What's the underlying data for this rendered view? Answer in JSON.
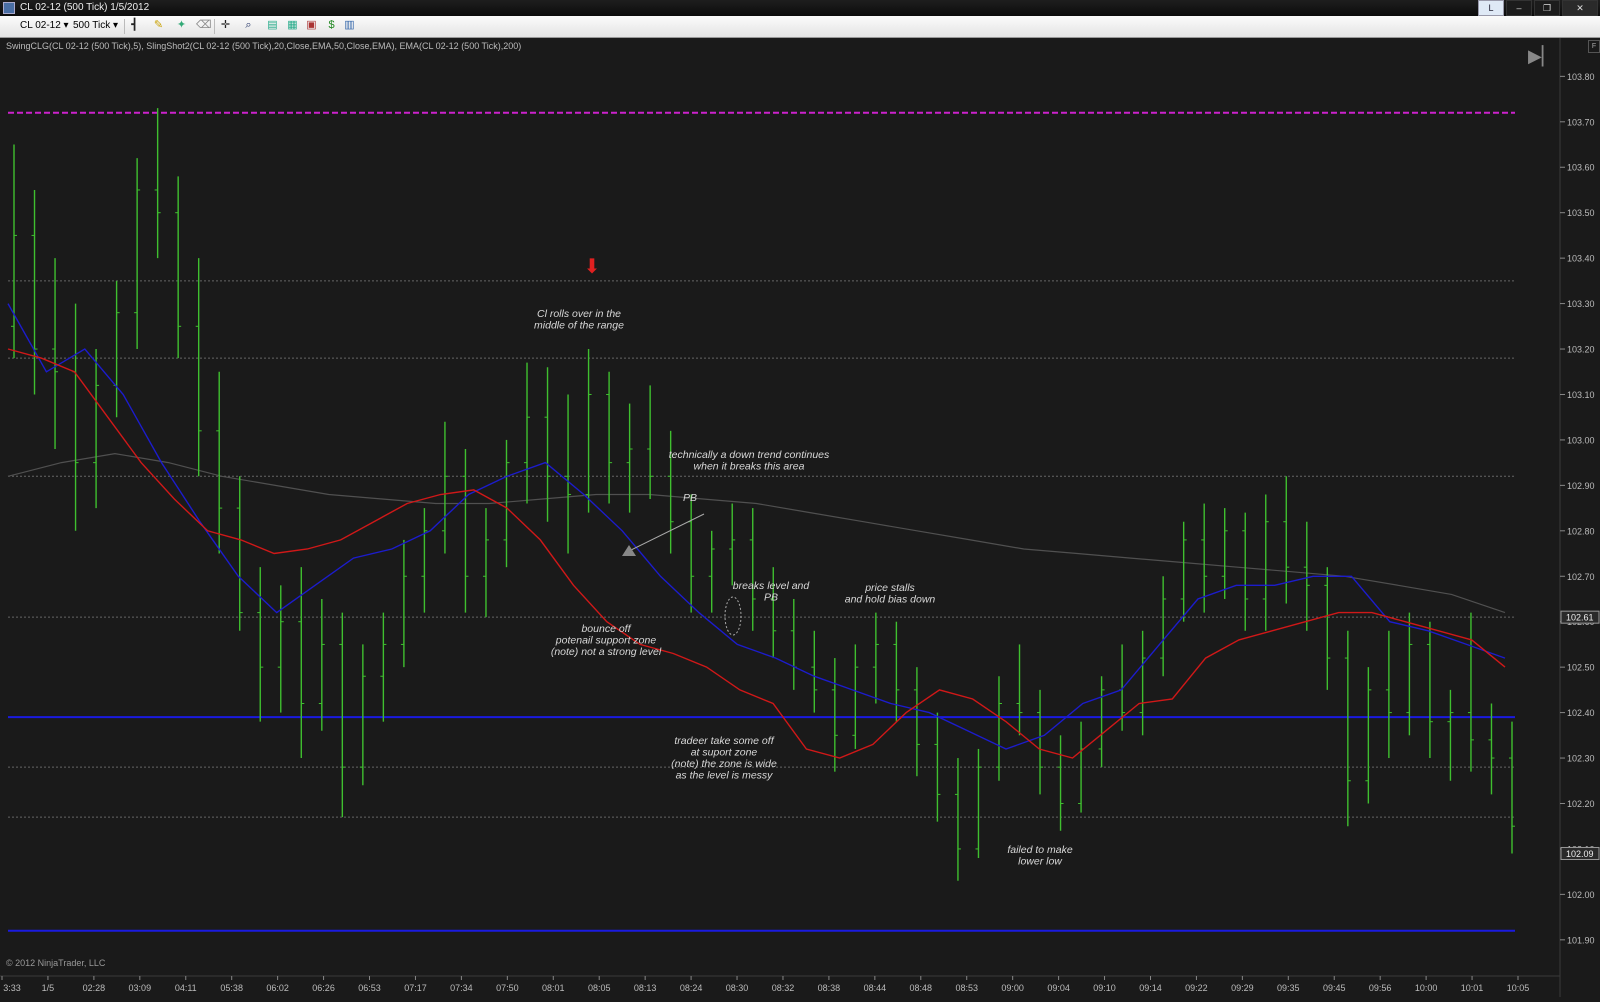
{
  "window": {
    "title": "CL 02-12 (500 Tick)  1/5/2012",
    "buttons": [
      "L",
      "–",
      "❐",
      "✕"
    ]
  },
  "toolbar": {
    "instrument": "CL 02-12",
    "interval": "500 Tick",
    "icons": [
      "bar-style-icon",
      "pencil-icon",
      "pin-icon",
      "eraser-icon",
      "crosshair-icon",
      "magnify-icon",
      "strategy-icon",
      "data-box-icon",
      "properties-icon",
      "save-icon",
      "layout-icon"
    ]
  },
  "indicator_label": "SwingCLG(CL 02-12 (500 Tick),5), SlingShot2(CL 02-12 (500 Tick),20,Close,EMA,50,Close,EMA), EMA(CL 02-12 (500 Tick),200)",
  "copyright": "© 2012 NinjaTrader, LLC",
  "colors": {
    "background": "#1a1a1a",
    "bars": "#3fbf2f",
    "ema_fast": "#d01818",
    "ema_slow": "#1c1ccc",
    "ema_200": "#505050",
    "level_magenta": "#cc22cc",
    "level_blue": "#1a1ae0",
    "level_gray": "#666666",
    "arrow_red": "#e02020"
  },
  "chart_data": {
    "type": "ohlc",
    "instrument": "CL 02-12",
    "interval": "500 Tick",
    "y_axis": {
      "range": [
        101.86,
        103.88
      ],
      "ticks": [
        "103.80",
        "103.70",
        "103.60",
        "103.50",
        "103.40",
        "103.30",
        "103.20",
        "103.10",
        "103.00",
        "102.90",
        "102.80",
        "102.70",
        "102.60",
        "102.50",
        "102.40",
        "102.30",
        "102.20",
        "102.10",
        "102.00",
        "101.90"
      ]
    },
    "x_axis": {
      "ticks": [
        "3:33",
        "1/5",
        "02:28",
        "03:09",
        "04:11",
        "05:38",
        "06:02",
        "06:26",
        "06:53",
        "07:17",
        "07:34",
        "07:50",
        "08:01",
        "08:05",
        "08:13",
        "08:24",
        "08:30",
        "08:32",
        "08:38",
        "08:44",
        "08:48",
        "08:53",
        "09:00",
        "09:04",
        "09:10",
        "09:14",
        "09:22",
        "09:29",
        "09:35",
        "09:45",
        "09:56",
        "10:00",
        "10:01",
        "10:05"
      ]
    },
    "price_markers": [
      {
        "label": "102.61",
        "value": 102.61
      },
      {
        "label": "102.09",
        "value": 102.09
      }
    ],
    "bars": [
      {
        "o": 103.25,
        "h": 103.65,
        "l": 103.18,
        "c": 103.45
      },
      {
        "o": 103.45,
        "h": 103.55,
        "l": 103.1,
        "c": 103.2
      },
      {
        "o": 103.2,
        "h": 103.4,
        "l": 102.98,
        "c": 103.15
      },
      {
        "o": 103.15,
        "h": 103.3,
        "l": 102.8,
        "c": 102.95
      },
      {
        "o": 102.95,
        "h": 103.2,
        "l": 102.85,
        "c": 103.12
      },
      {
        "o": 103.12,
        "h": 103.35,
        "l": 103.05,
        "c": 103.28
      },
      {
        "o": 103.28,
        "h": 103.62,
        "l": 103.2,
        "c": 103.55
      },
      {
        "o": 103.55,
        "h": 103.73,
        "l": 103.4,
        "c": 103.5
      },
      {
        "o": 103.5,
        "h": 103.58,
        "l": 103.18,
        "c": 103.25
      },
      {
        "o": 103.25,
        "h": 103.4,
        "l": 102.92,
        "c": 103.02
      },
      {
        "o": 103.02,
        "h": 103.15,
        "l": 102.75,
        "c": 102.85
      },
      {
        "o": 102.85,
        "h": 102.92,
        "l": 102.58,
        "c": 102.62
      },
      {
        "o": 102.62,
        "h": 102.72,
        "l": 102.38,
        "c": 102.5
      },
      {
        "o": 102.5,
        "h": 102.68,
        "l": 102.4,
        "c": 102.6
      },
      {
        "o": 102.6,
        "h": 102.72,
        "l": 102.3,
        "c": 102.42
      },
      {
        "o": 102.42,
        "h": 102.65,
        "l": 102.36,
        "c": 102.55
      },
      {
        "o": 102.55,
        "h": 102.62,
        "l": 102.17,
        "c": 102.28
      },
      {
        "o": 102.28,
        "h": 102.55,
        "l": 102.24,
        "c": 102.48
      },
      {
        "o": 102.48,
        "h": 102.62,
        "l": 102.38,
        "c": 102.55
      },
      {
        "o": 102.55,
        "h": 102.78,
        "l": 102.5,
        "c": 102.7
      },
      {
        "o": 102.7,
        "h": 102.85,
        "l": 102.62,
        "c": 102.8
      },
      {
        "o": 102.8,
        "h": 103.04,
        "l": 102.75,
        "c": 102.92
      },
      {
        "o": 102.92,
        "h": 102.98,
        "l": 102.62,
        "c": 102.7
      },
      {
        "o": 102.7,
        "h": 102.85,
        "l": 102.61,
        "c": 102.78
      },
      {
        "o": 102.78,
        "h": 103.0,
        "l": 102.72,
        "c": 102.95
      },
      {
        "o": 102.95,
        "h": 103.17,
        "l": 102.86,
        "c": 103.05
      },
      {
        "o": 103.05,
        "h": 103.16,
        "l": 102.82,
        "c": 102.92
      },
      {
        "o": 102.92,
        "h": 103.1,
        "l": 102.75,
        "c": 102.88
      },
      {
        "o": 102.88,
        "h": 103.2,
        "l": 102.84,
        "c": 103.1
      },
      {
        "o": 103.1,
        "h": 103.15,
        "l": 102.86,
        "c": 102.95
      },
      {
        "o": 102.95,
        "h": 103.08,
        "l": 102.84,
        "c": 102.98
      },
      {
        "o": 102.98,
        "h": 103.12,
        "l": 102.87,
        "c": 102.92
      },
      {
        "o": 102.92,
        "h": 103.02,
        "l": 102.75,
        "c": 102.82
      },
      {
        "o": 102.82,
        "h": 102.88,
        "l": 102.62,
        "c": 102.7
      },
      {
        "o": 102.7,
        "h": 102.8,
        "l": 102.62,
        "c": 102.76
      },
      {
        "o": 102.76,
        "h": 102.86,
        "l": 102.68,
        "c": 102.78
      },
      {
        "o": 102.78,
        "h": 102.85,
        "l": 102.58,
        "c": 102.65
      },
      {
        "o": 102.65,
        "h": 102.72,
        "l": 102.52,
        "c": 102.58
      },
      {
        "o": 102.58,
        "h": 102.65,
        "l": 102.45,
        "c": 102.5
      },
      {
        "o": 102.5,
        "h": 102.58,
        "l": 102.4,
        "c": 102.45
      },
      {
        "o": 102.45,
        "h": 102.52,
        "l": 102.27,
        "c": 102.35
      },
      {
        "o": 102.35,
        "h": 102.55,
        "l": 102.32,
        "c": 102.5
      },
      {
        "o": 102.5,
        "h": 102.62,
        "l": 102.42,
        "c": 102.55
      },
      {
        "o": 102.55,
        "h": 102.6,
        "l": 102.38,
        "c": 102.45
      },
      {
        "o": 102.45,
        "h": 102.5,
        "l": 102.26,
        "c": 102.33
      },
      {
        "o": 102.33,
        "h": 102.4,
        "l": 102.16,
        "c": 102.22
      },
      {
        "o": 102.22,
        "h": 102.3,
        "l": 102.03,
        "c": 102.1
      },
      {
        "o": 102.1,
        "h": 102.32,
        "l": 102.08,
        "c": 102.28
      },
      {
        "o": 102.28,
        "h": 102.48,
        "l": 102.25,
        "c": 102.42
      },
      {
        "o": 102.42,
        "h": 102.55,
        "l": 102.35,
        "c": 102.4
      },
      {
        "o": 102.4,
        "h": 102.45,
        "l": 102.22,
        "c": 102.28
      },
      {
        "o": 102.28,
        "h": 102.35,
        "l": 102.14,
        "c": 102.2
      },
      {
        "o": 102.2,
        "h": 102.38,
        "l": 102.18,
        "c": 102.32
      },
      {
        "o": 102.32,
        "h": 102.48,
        "l": 102.28,
        "c": 102.45
      },
      {
        "o": 102.45,
        "h": 102.55,
        "l": 102.36,
        "c": 102.4
      },
      {
        "o": 102.4,
        "h": 102.58,
        "l": 102.35,
        "c": 102.52
      },
      {
        "o": 102.52,
        "h": 102.7,
        "l": 102.48,
        "c": 102.65
      },
      {
        "o": 102.65,
        "h": 102.82,
        "l": 102.6,
        "c": 102.78
      },
      {
        "o": 102.78,
        "h": 102.86,
        "l": 102.62,
        "c": 102.7
      },
      {
        "o": 102.7,
        "h": 102.85,
        "l": 102.65,
        "c": 102.8
      },
      {
        "o": 102.8,
        "h": 102.84,
        "l": 102.58,
        "c": 102.65
      },
      {
        "o": 102.65,
        "h": 102.88,
        "l": 102.58,
        "c": 102.82
      },
      {
        "o": 102.82,
        "h": 102.92,
        "l": 102.64,
        "c": 102.72
      },
      {
        "o": 102.72,
        "h": 102.82,
        "l": 102.58,
        "c": 102.68
      },
      {
        "o": 102.68,
        "h": 102.72,
        "l": 102.45,
        "c": 102.52
      },
      {
        "o": 102.52,
        "h": 102.58,
        "l": 102.15,
        "c": 102.25
      },
      {
        "o": 102.25,
        "h": 102.5,
        "l": 102.2,
        "c": 102.45
      },
      {
        "o": 102.45,
        "h": 102.58,
        "l": 102.3,
        "c": 102.4
      },
      {
        "o": 102.4,
        "h": 102.62,
        "l": 102.35,
        "c": 102.55
      },
      {
        "o": 102.55,
        "h": 102.6,
        "l": 102.3,
        "c": 102.38
      },
      {
        "o": 102.38,
        "h": 102.45,
        "l": 102.25,
        "c": 102.4
      },
      {
        "o": 102.4,
        "h": 102.62,
        "l": 102.27,
        "c": 102.34
      },
      {
        "o": 102.34,
        "h": 102.42,
        "l": 102.22,
        "c": 102.3
      },
      {
        "o": 102.3,
        "h": 102.38,
        "l": 102.09,
        "c": 102.15
      }
    ],
    "ema_fast": [
      103.2,
      103.18,
      103.15,
      103.05,
      102.95,
      102.87,
      102.8,
      102.78,
      102.75,
      102.76,
      102.78,
      102.82,
      102.86,
      102.88,
      102.89,
      102.85,
      102.78,
      102.68,
      102.6,
      102.55,
      102.53,
      102.5,
      102.45,
      102.42,
      102.32,
      102.3,
      102.33,
      102.4,
      102.45,
      102.43,
      102.38,
      102.32,
      102.3,
      102.36,
      102.42,
      102.43,
      102.52,
      102.56,
      102.58,
      102.6,
      102.62,
      102.62,
      102.6,
      102.58,
      102.56,
      102.5
    ],
    "ema_slow": [
      103.3,
      103.15,
      103.2,
      103.1,
      102.95,
      102.82,
      102.7,
      102.62,
      102.68,
      102.74,
      102.76,
      102.8,
      102.88,
      102.92,
      102.95,
      102.88,
      102.8,
      102.7,
      102.62,
      102.55,
      102.52,
      102.48,
      102.45,
      102.42,
      102.4,
      102.36,
      102.32,
      102.35,
      102.42,
      102.45,
      102.55,
      102.65,
      102.68,
      102.68,
      102.7,
      102.7,
      102.6,
      102.58,
      102.55,
      102.52
    ],
    "ema_200": [
      102.92,
      102.95,
      102.97,
      102.95,
      102.92,
      102.9,
      102.88,
      102.87,
      102.86,
      102.86,
      102.87,
      102.88,
      102.88,
      102.87,
      102.86,
      102.84,
      102.82,
      102.8,
      102.78,
      102.76,
      102.75,
      102.74,
      102.73,
      102.72,
      102.71,
      102.7,
      102.68,
      102.66,
      102.62
    ],
    "levels": [
      {
        "type": "magenta-dashed",
        "value": 103.72
      },
      {
        "type": "blue",
        "value": 102.39
      },
      {
        "type": "blue",
        "value": 101.92
      },
      {
        "type": "gray-dotted",
        "value": 103.18
      },
      {
        "type": "gray-dotted",
        "value": 102.61
      },
      {
        "type": "gray-dotted",
        "value": 102.17
      },
      {
        "type": "gray-dotted",
        "value": 103.35
      },
      {
        "type": "gray-dotted",
        "value": 102.92
      },
      {
        "type": "gray-dotted",
        "value": 102.28
      }
    ],
    "annotations": [
      {
        "lines": [
          "Cl rolls over in the",
          "middle of the range"
        ]
      },
      {
        "lines": [
          "technically a down trend continues",
          "when it breaks this area"
        ]
      },
      {
        "lines": [
          "PB"
        ]
      },
      {
        "lines": [
          "bounce off",
          "potenail support zone",
          "(note)  not a strong level"
        ]
      },
      {
        "lines": [
          "breaks level and",
          "PB"
        ]
      },
      {
        "lines": [
          "price stalls",
          "and hold bias down"
        ]
      },
      {
        "lines": [
          "tradeer take some off",
          "at suport zone",
          "(note)  the zone is wide",
          "as the level is messy"
        ]
      },
      {
        "lines": [
          "failed to make",
          "lower low"
        ]
      }
    ]
  }
}
